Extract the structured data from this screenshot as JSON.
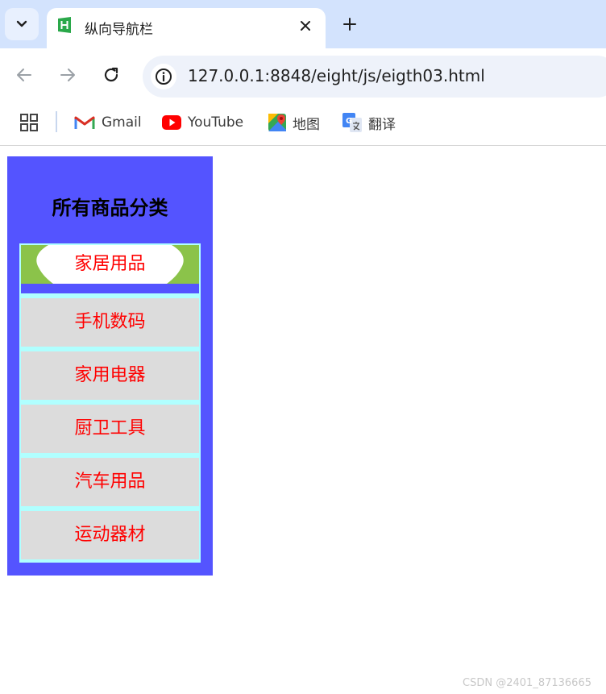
{
  "browser": {
    "tab": {
      "title": "纵向导航栏",
      "favicon_icon": "hbuilder-h-icon"
    },
    "url": "127.0.0.1:8848/eight/js/eigth03.html",
    "bookmarks": [
      {
        "label": "Gmail",
        "icon": "gmail-icon"
      },
      {
        "label": "YouTube",
        "icon": "youtube-icon"
      },
      {
        "label": "地图",
        "icon": "maps-icon"
      },
      {
        "label": "翻译",
        "icon": "translate-icon"
      }
    ]
  },
  "page": {
    "heading": "所有商品分类",
    "menu_items": [
      {
        "label": "家居用品",
        "state": "hover"
      },
      {
        "label": "手机数码",
        "state": "normal"
      },
      {
        "label": "家用电器",
        "state": "normal"
      },
      {
        "label": "厨卫工具",
        "state": "normal"
      },
      {
        "label": "汽车用品",
        "state": "normal"
      },
      {
        "label": "运动器材",
        "state": "normal"
      }
    ]
  },
  "watermark": "CSDN @2401_87136665",
  "colors": {
    "panel_bg": "#5454ff",
    "item_bg": "#dcdcdc",
    "item_text": "#ff0000",
    "list_border": "#b0ffff"
  }
}
